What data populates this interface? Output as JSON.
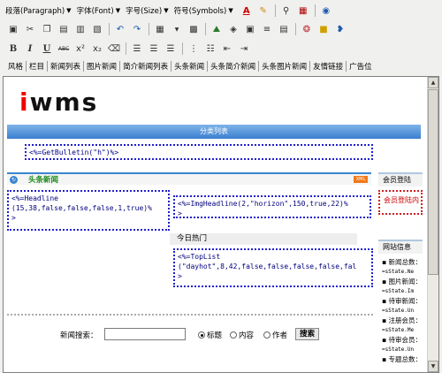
{
  "toolbar": {
    "dropdowns": [
      "段落(Paragraph)",
      "字体(Font)",
      "字号(Size)",
      "符号(Symbols)"
    ],
    "row3_separator": "|",
    "words": [
      "风格",
      "栏目",
      "新闻列表",
      "图片新闻",
      "简介新闻列表",
      "头条新闻",
      "头条简介新闻",
      "头条图片新闻",
      "友情链接",
      "广告位"
    ]
  },
  "page": {
    "logo_text": "iwms",
    "category_bar": "分类列表",
    "bulletin_code": "<%=GetBulletin(\"h\")%>",
    "headline_section_title": "头条新闻",
    "xml_badge": "XML",
    "headline_code_1": "<%=Headline",
    "headline_code_2": "(15,38,false,false,false,1,true)%",
    "headline_code_3": ">",
    "img_headline_code_1": "<%=ImgHeadline(2,\"horizon\",150,true,22)%",
    "img_headline_code_2": ">",
    "hot_title": "今日热门",
    "toplist_code_1": "<%=TopList",
    "toplist_code_2": "(\"dayhot\",8,42,false,false,false,false,fal",
    "toplist_code_3": ">",
    "login_title": "会员登陆",
    "login_box": "会员登陆内",
    "stats_title": "网站信息",
    "stats": [
      {
        "label": "新闻总数：",
        "code": "=sState.Ne"
      },
      {
        "label": "图片新闻：",
        "code": "=sState.Im"
      },
      {
        "label": "待审新闻：",
        "code": "=sState.Un"
      },
      {
        "label": "注册会员：",
        "code": "=sState.Me"
      },
      {
        "label": "待审会员：",
        "code": "=sState.Un"
      },
      {
        "label": "专题总数：",
        "code": ""
      }
    ],
    "search_label": "新闻搜索：",
    "search_value": "",
    "search_options": [
      "标题",
      "内容",
      "作者"
    ],
    "search_button": "搜索"
  }
}
